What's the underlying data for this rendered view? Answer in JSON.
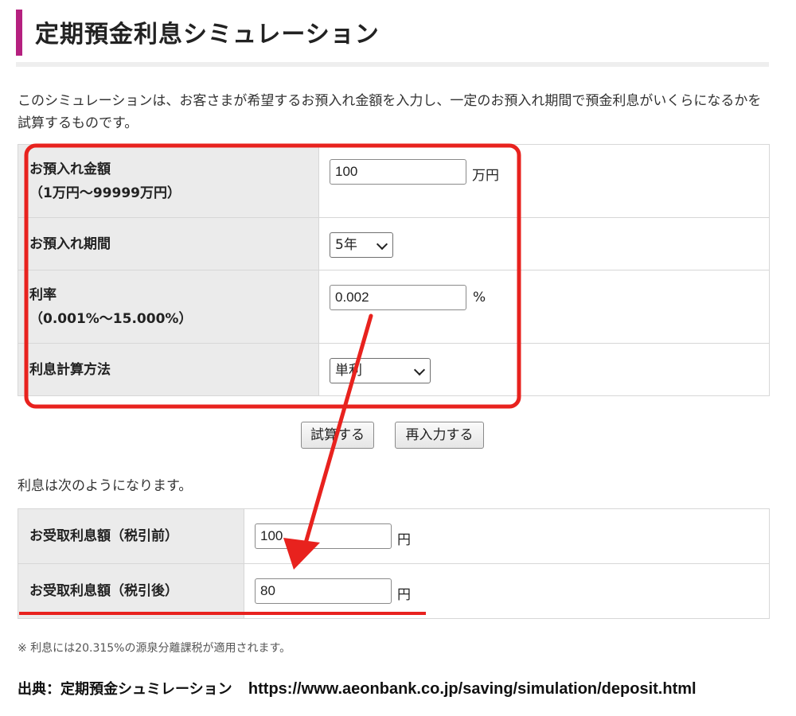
{
  "page": {
    "title": "定期預金利息シミュレーション",
    "intro": "このシミュレーションは、お客さまが希望するお預入れ金額を入力し、一定のお預入れ期間で預金利息がいくらになるかを試算するものです。"
  },
  "form": {
    "amount": {
      "label": "お預入れ金額",
      "sub_label": "（1万円～99999万円）",
      "value": "100",
      "unit": "万円"
    },
    "period": {
      "label": "お預入れ期間",
      "selected": "5年"
    },
    "rate": {
      "label": "利率",
      "sub_label": "（0.001%～15.000%）",
      "value": "0.002",
      "unit": "%"
    },
    "method": {
      "label": "利息計算方法",
      "selected": "単利"
    }
  },
  "buttons": {
    "calculate": "試算する",
    "reset": "再入力する"
  },
  "result": {
    "intro": "利息は次のようになります。",
    "before_tax": {
      "label": "お受取利息額（税引前）",
      "value": "100",
      "unit": "円"
    },
    "after_tax": {
      "label": "お受取利息額（税引後）",
      "value": "80",
      "unit": "円"
    }
  },
  "note": "※ 利息には20.315%の源泉分離課税が適用されます。",
  "source": {
    "label": "出典：定期預金シュミレーション",
    "url": "https://www.aeonbank.co.jp/saving/simulation/deposit.html"
  },
  "colors": {
    "accent": "#b5207f",
    "annotation_red": "#e8221e",
    "label_bg": "#ebebeb"
  }
}
